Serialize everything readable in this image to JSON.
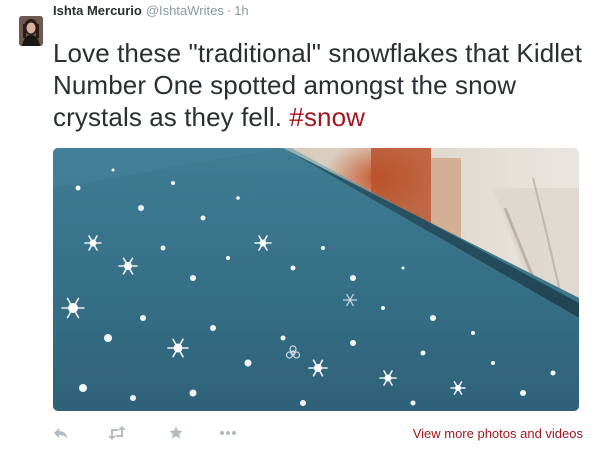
{
  "tweet": {
    "author": {
      "display_name": "Ishta Mercurio",
      "handle": "@IshtaWrites",
      "separator": "·",
      "timestamp": "1h",
      "avatar": "profile-photo"
    },
    "text_lines": [
      "Love these \"traditional\" snowflakes that Kidlet",
      "Number One spotted amongst the snow",
      "crystals as they fell. "
    ],
    "hashtag": "#snow",
    "media": {
      "type": "photo",
      "subject": "snowflakes on a blue painted railing"
    },
    "actions": {
      "icons": [
        "reply-icon",
        "retweet-icon",
        "favorite-icon",
        "more-icon"
      ],
      "view_more_label": "View more photos and videos"
    }
  },
  "colors": {
    "text": "#292f33",
    "meta": "#8899a6",
    "accent": "#a2171e",
    "action_icon": "#b3bcc3"
  }
}
